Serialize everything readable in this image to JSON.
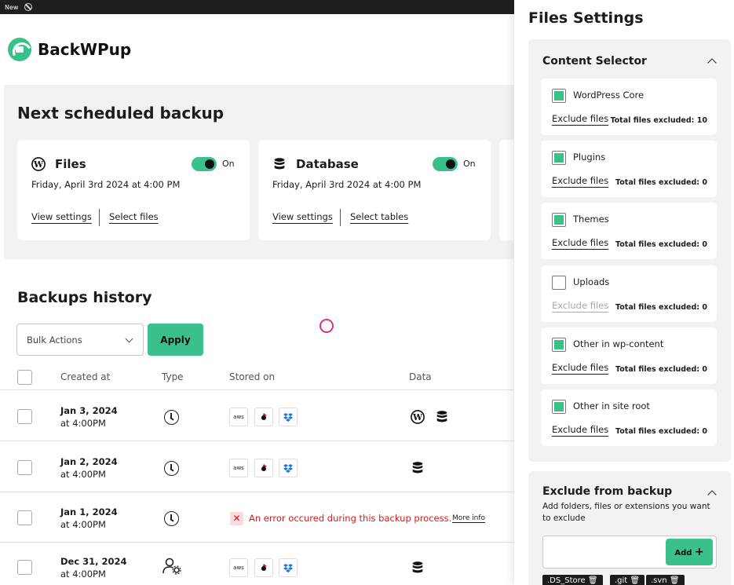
{
  "topbar": {
    "label": "New"
  },
  "app": {
    "name": "BackWPup"
  },
  "schedule": {
    "title": "Next scheduled backup",
    "cards": [
      {
        "title": "Files",
        "state": "On",
        "date": "Friday, April 3rd 2024 at 4:00 PM",
        "link1": "View settings",
        "link2": "Select files"
      },
      {
        "title": "Database",
        "state": "On",
        "date": "Friday, April 3rd 2024 at 4:00 PM",
        "link1": "View settings",
        "link2": "Select tables"
      }
    ]
  },
  "history": {
    "title": "Backups history",
    "bulk_actions": "Bulk Actions",
    "apply": "Apply",
    "columns": [
      "Created at",
      "Type",
      "Stored on",
      "Data"
    ],
    "rows": [
      {
        "date": "Jan 3, 2024",
        "time": "at 4:00PM",
        "type": "clock-icon",
        "storage": [
          "aws",
          "rackspace",
          "dropbox"
        ],
        "data": [
          "wordpress-icon",
          "database-icon"
        ]
      },
      {
        "date": "Jan 2, 2024",
        "time": "at 4:00PM",
        "type": "clock-icon",
        "storage": [
          "aws",
          "rackspace",
          "dropbox"
        ],
        "data": [
          "database-icon"
        ]
      },
      {
        "date": "Jan 1, 2024",
        "time": "at 4:00PM",
        "type": "clock-icon",
        "error": "An error occured during this backup process.",
        "more_info": "More info"
      },
      {
        "date": "Dec 31, 2024",
        "time": "at 4:00PM",
        "type": "user-gear-icon",
        "storage": [
          "aws",
          "rackspace",
          "dropbox"
        ],
        "data": [
          "database-icon"
        ]
      }
    ],
    "aws_label": "aws"
  },
  "panel": {
    "title": "Files Settings",
    "content_selector": {
      "title": "Content Selector",
      "items": [
        {
          "label": "WordPress Core",
          "checked": true,
          "exclude": "Exclude files",
          "total": "Total files excluded: 10"
        },
        {
          "label": "Plugins",
          "checked": true,
          "exclude": "Exclude files",
          "total": "Total files excluded: 0"
        },
        {
          "label": "Themes",
          "checked": true,
          "exclude": "Exclude files",
          "total": "Total files excluded: 0"
        },
        {
          "label": "Uploads",
          "checked": false,
          "exclude": "Exclude files",
          "total": "Total files excluded: 0"
        },
        {
          "label": "Other in wp-content",
          "checked": true,
          "exclude": "Exclude files",
          "total": "Total files excluded: 0"
        },
        {
          "label": "Other in site root",
          "checked": true,
          "exclude": "Exclude files",
          "total": "Total files excluded: 0"
        }
      ]
    },
    "exclude": {
      "title": "Exclude from backup",
      "description": "Add folders, files or extensions you want to exclude",
      "add": "Add",
      "tags": [
        ".DS_Store",
        ".git",
        ".svn"
      ]
    }
  },
  "colors": {
    "accent": "#3ac08b",
    "error": "#d31c1c",
    "cursor": "#e52a92"
  }
}
